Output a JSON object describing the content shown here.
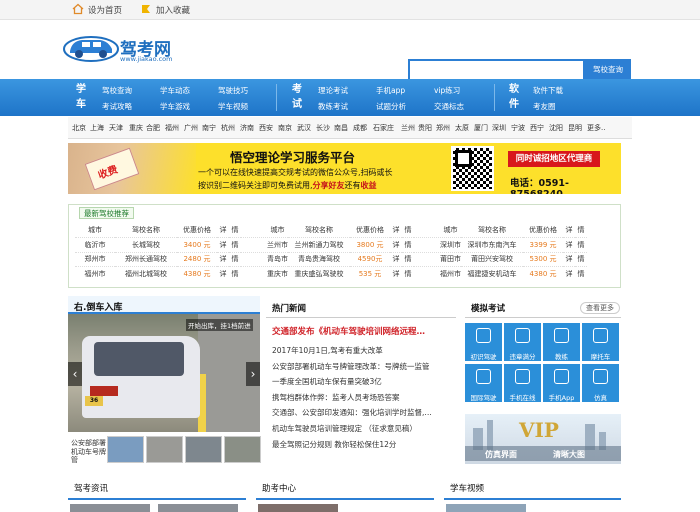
{
  "topbar": {
    "set_home": "设为首页",
    "add_favorite": "加入收藏"
  },
  "logo": {
    "name": "驾考网",
    "domain": "www.jiakao.com"
  },
  "search": {
    "placeholder": "",
    "button": "驾校查询"
  },
  "nav": {
    "groups": [
      {
        "label": "学车",
        "links": [
          "驾校查询",
          "考试攻略",
          "学车动态",
          "学车游戏",
          "驾驶技巧",
          "学车视频"
        ]
      },
      {
        "label": "考试",
        "links": [
          "理论考试",
          "教练考试",
          "手机app",
          "试题分析",
          "vip练习",
          "交通标志"
        ]
      },
      {
        "label": "软件",
        "links": [
          "软件下载",
          "考友圈"
        ]
      }
    ]
  },
  "cities": [
    "北京",
    "上海",
    "天津",
    "重庆",
    "合肥",
    "福州",
    "广州",
    "南宁",
    "杭州",
    "济南",
    "西安",
    "南京",
    "武汉",
    "长沙",
    "南昌",
    "成都",
    "石家庄",
    "兰州",
    "贵阳",
    "郑州",
    "太原",
    "厦门",
    "深圳",
    "宁波",
    "西宁",
    "沈阳",
    "昆明",
    "更多.."
  ],
  "banner": {
    "ticket": "收费",
    "title": "悟空理论学习服务平台",
    "line1": "一个可以在线快速提高交规考试的微信公众号,扫码或长",
    "line2_prefix": "按识别二维码关注即可免费试用,",
    "line2_highlight_a": "分享好友",
    "line2_mid": "还有",
    "line2_highlight_b": "收益",
    "agent": "同时诚招地区代理商",
    "phone": "电话：0591-87568240"
  },
  "recommend": {
    "tab": "最新驾校推荐",
    "headers": [
      "城市",
      "驾校名称",
      "优惠价格",
      "详",
      "情"
    ],
    "rows": [
      [
        [
          "临沂市",
          "长城驾校",
          "3400 元",
          "详",
          "情"
        ],
        [
          "兰州市",
          "兰州新通力驾校",
          "3800 元",
          "详",
          "情"
        ],
        [
          "深圳市",
          "深圳市东南汽车",
          "3399 元",
          "详",
          "情"
        ]
      ],
      [
        [
          "郑州市",
          "郑州长通驾校",
          "2480 元",
          "详",
          "情"
        ],
        [
          "青岛市",
          "青岛贵海驾校",
          "4590元",
          "详",
          "情"
        ],
        [
          "莆田市",
          "莆田兴安驾校",
          "5300 元",
          "详",
          "情"
        ]
      ],
      [
        [
          "福州市",
          "福州北城驾校",
          "4380 元",
          "详",
          "情"
        ],
        [
          "重庆市",
          "重庆盛弘驾驶校",
          "535 元",
          "详",
          "情"
        ],
        [
          "福州市",
          "福建捷安机动车",
          "4380 元",
          "详",
          "情"
        ]
      ]
    ]
  },
  "left": {
    "title": "右.倒车入库",
    "photo_caption": "开始出库，挂1档前进",
    "plate": "36",
    "thumb_caption": "公安部部署机动车号牌管"
  },
  "news": {
    "title": "热门新闻",
    "lead": "交通部发布《机动车驾驶培训网络远程…",
    "items": [
      "2017年10月1日,驾考有重大改革",
      "公安部部署机动车号牌管理改革：号牌统一监管",
      "一季度全国机动车保有量突破3亿",
      "携驾档群体作弊：监考人员考场恐答案",
      "交通部、公安部印发通知：强化培训学时监督,…",
      "机动车驾驶员培训管理规定 （征求意见稿）",
      "最全驾照记分规则 教你轻松保住12分"
    ]
  },
  "exam": {
    "title": "模拟考试",
    "more": "查看更多",
    "tiles": [
      "初识驾驶",
      "违章满分",
      "教练",
      "摩托车",
      "国际驾驶",
      "手机在线",
      "手机App",
      "仿真"
    ],
    "vip": "VIP",
    "vip_left": "仿真界面",
    "vip_right": "清晰大图"
  },
  "bottom": [
    "驾考资讯",
    "助考中心",
    "学车视频"
  ],
  "colors": {
    "nav_blue": "#2c7fd4",
    "price_orange": "#e67a1e",
    "news_red": "#d0242a",
    "banner_yellow": "#fde02b"
  }
}
